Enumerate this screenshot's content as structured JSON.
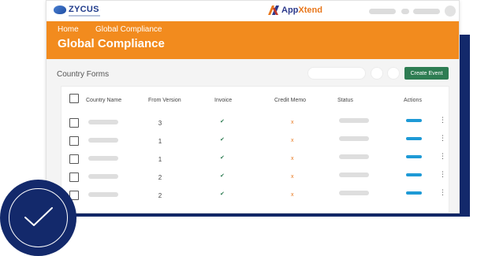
{
  "brand": {
    "company": "ZYCUS",
    "product_a": "App",
    "product_b": "Xtend"
  },
  "colors": {
    "banner": "#f28b1e",
    "navy": "#13296b",
    "accent_green": "#2e7d53",
    "action_blue": "#1e9ad6"
  },
  "breadcrumb": {
    "home": "Home",
    "current": "Global Compliance"
  },
  "page_title": "Global Compliance",
  "section": {
    "title": "Country Forms",
    "create_button": "Create Event"
  },
  "table": {
    "columns": [
      "Country Name",
      "From Version",
      "Invoice",
      "Credit Memo",
      "Status",
      "Actions"
    ],
    "rows": [
      {
        "from_version": "3",
        "invoice": "✔",
        "credit_memo": "x"
      },
      {
        "from_version": "1",
        "invoice": "✔",
        "credit_memo": "x"
      },
      {
        "from_version": "1",
        "invoice": "✔",
        "credit_memo": "x"
      },
      {
        "from_version": "2",
        "invoice": "✔",
        "credit_memo": "x"
      },
      {
        "from_version": "2",
        "invoice": "✔",
        "credit_memo": "x"
      }
    ],
    "row_menu": "⋮"
  }
}
